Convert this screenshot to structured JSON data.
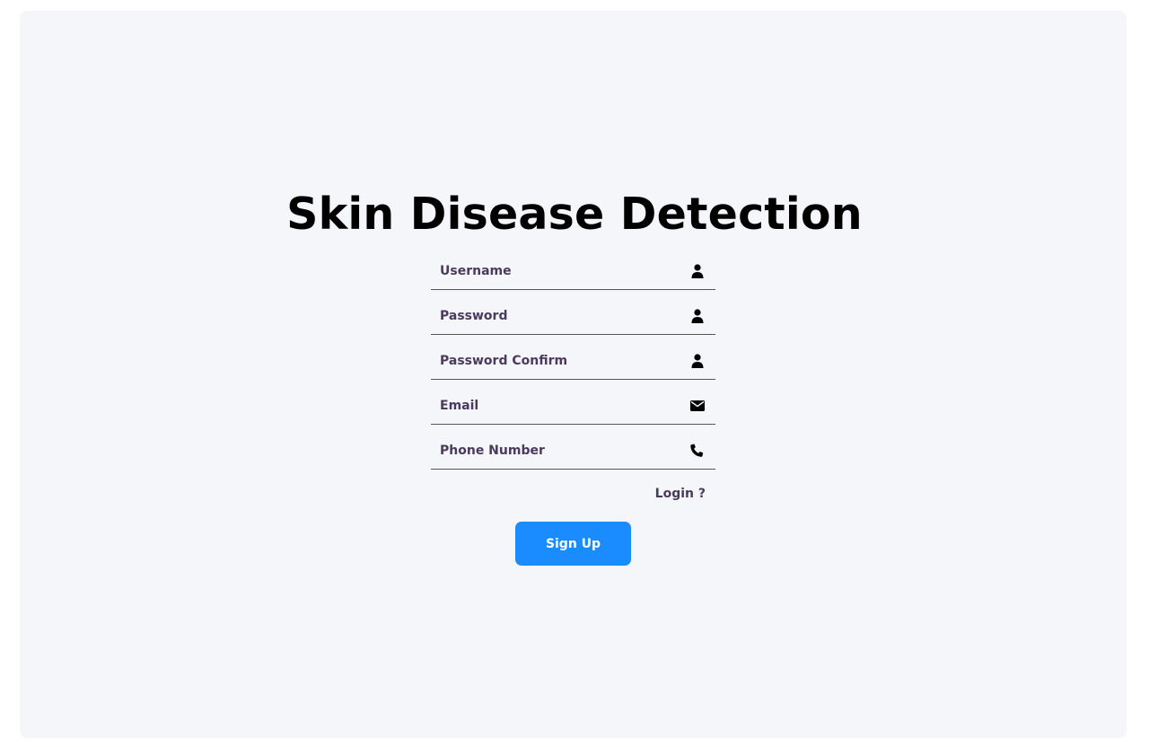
{
  "page": {
    "title": "Skin Disease Detection"
  },
  "form": {
    "fields": [
      {
        "placeholder": "Username",
        "icon": "user-icon"
      },
      {
        "placeholder": "Password",
        "icon": "user-icon"
      },
      {
        "placeholder": "Password Confirm",
        "icon": "user-icon"
      },
      {
        "placeholder": "Email",
        "icon": "envelope-icon"
      },
      {
        "placeholder": "Phone Number",
        "icon": "phone-icon"
      }
    ],
    "login_link": "Login ?",
    "submit_label": "Sign Up"
  },
  "colors": {
    "background": "#f5f6fa",
    "accent": "#1a8cff",
    "label": "#4a3a5e"
  }
}
